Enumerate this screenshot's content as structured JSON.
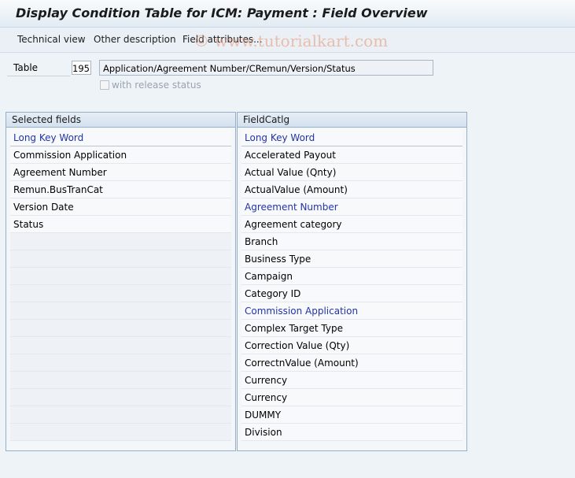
{
  "title": "Display Condition Table for ICM: Payment : Field Overview",
  "toolbar": {
    "technical_view": "Technical view",
    "other_description": "Other description",
    "field_attributes": "Field attributes..."
  },
  "watermark": "© www.tutorialkart.com",
  "form": {
    "table_label": "Table",
    "table_number": "195",
    "table_description": "Application/Agreement Number/CRemun/Version/Status",
    "release_status_label": "with release status",
    "release_status_checked": false
  },
  "selected_fields": {
    "header": "Selected fields",
    "column_title": "Long Key Word",
    "items": [
      "Commission Application",
      "Agreement Number",
      "Remun.BusTranCat",
      "Version Date",
      "Status"
    ]
  },
  "field_catalog": {
    "header": "FieldCatlg",
    "column_title": "Long Key Word",
    "items": [
      {
        "label": "Accelerated Payout",
        "highlighted": false
      },
      {
        "label": "Actual Value (Qnty)",
        "highlighted": false
      },
      {
        "label": "ActualValue (Amount)",
        "highlighted": false
      },
      {
        "label": "Agreement Number",
        "highlighted": true
      },
      {
        "label": "Agreement category",
        "highlighted": false
      },
      {
        "label": "Branch",
        "highlighted": false
      },
      {
        "label": "Business Type",
        "highlighted": false
      },
      {
        "label": "Campaign",
        "highlighted": false
      },
      {
        "label": "Category ID",
        "highlighted": false
      },
      {
        "label": "Commission Application",
        "highlighted": true
      },
      {
        "label": "Complex Target Type",
        "highlighted": false
      },
      {
        "label": "Correction Value (Qty)",
        "highlighted": false
      },
      {
        "label": "CorrectnValue (Amount)",
        "highlighted": false
      },
      {
        "label": "Currency",
        "highlighted": false
      },
      {
        "label": "Currency",
        "highlighted": false
      },
      {
        "label": "DUMMY",
        "highlighted": false
      },
      {
        "label": "Division",
        "highlighted": false
      }
    ]
  },
  "colors": {
    "highlight_text": "#2233aa",
    "watermark": "#e6966e"
  }
}
